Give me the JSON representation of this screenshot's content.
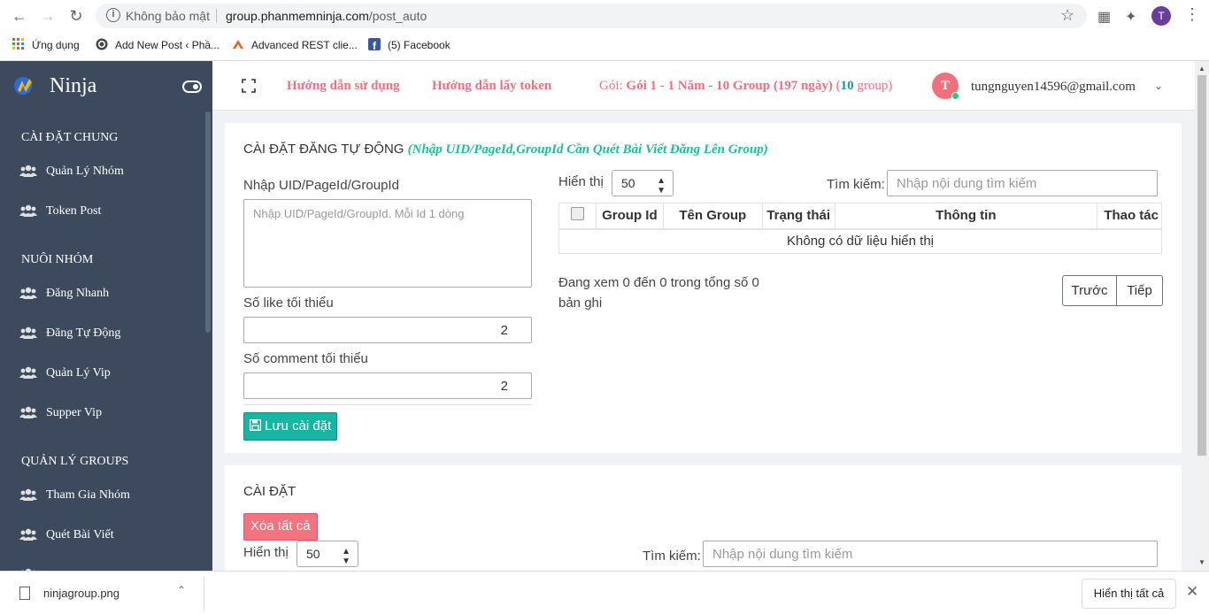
{
  "browser": {
    "insecure_label": "Không bảo mật",
    "url_host": "group.phanmemninja.com",
    "url_path": "/post_auto",
    "profile_initial": "T",
    "bookmarks": [
      {
        "label": "Ứng dụng",
        "icon": "apps-grid-icon"
      },
      {
        "label": "Add New Post ‹ Phầ...",
        "icon": "wordpress-icon"
      },
      {
        "label": "Advanced REST clie...",
        "icon": "rest-client-icon"
      },
      {
        "label": "(5) Facebook",
        "icon": "facebook-icon"
      }
    ]
  },
  "sidebar": {
    "brand": "Ninja",
    "sections": [
      {
        "title": "CÀI ĐẶT CHUNG",
        "items": [
          "Quản Lý Nhóm",
          "Token Post"
        ]
      },
      {
        "title": "NUÔI NHÓM",
        "items": [
          "Đăng Nhanh",
          "Đăng Tự Động",
          "Quản Lý Vip",
          "Supper Vip"
        ]
      },
      {
        "title": "QUẢN LÝ GROUPS",
        "items": [
          "Tham Gia Nhóm",
          "Quét Bài Viết"
        ]
      }
    ]
  },
  "header": {
    "guide_link": "Hướng dẫn sử dụng",
    "token_link": "Hướng dẫn lấy token",
    "package_prefix": "Gói: ",
    "package_name": "Gói 1 - 1 Năm - 10 Group (197 ngày)",
    "group_count": "10",
    "group_suffix": "group)",
    "avatar_initial": "T",
    "email": "tungnguyen14596@gmail.com"
  },
  "card1": {
    "title": "CÀI ĐẶT ĐĂNG TỰ ĐỘNG",
    "subtitle": "(Nhập UID/PageId,GroupId Cần Quét Bài Viết Đăng Lên Group)",
    "uid_label": "Nhập UID/PageId/GroupId",
    "uid_placeholder": "Nhập UID/PageId/GroupId. Mỗi Id 1 dòng",
    "min_like_label": "Số like tối thiểu",
    "min_like_value": "2",
    "min_comment_label": "Số comment tối thiểu",
    "min_comment_value": "2",
    "save_button": "Lưu cài đặt",
    "show_label": "Hiển thị",
    "page_size": "50",
    "search_label": "Tìm kiếm:",
    "search_placeholder": "Nhập nội dung tìm kiếm",
    "table_headers": [
      "Group Id",
      "Tên Group",
      "Trạng thái",
      "Thông tin",
      "Thao tác"
    ],
    "empty_text": "Không có dữ liệu hiển thị",
    "info_line1": "Đang xem 0 đến 0 trong tổng số 0",
    "info_line2": "bản ghi",
    "prev_button": "Trước",
    "next_button": "Tiếp"
  },
  "card2": {
    "title": "CÀI ĐẶT",
    "delete_all_button": "Xóa tất cả",
    "show_label": "Hiển thị",
    "page_size": "50",
    "search_label": "Tìm kiếm:",
    "search_placeholder": "Nhập nội dung tìm kiếm"
  },
  "downloads": {
    "file_name": "ninjagroup.png",
    "show_all": "Hiển thị tất cả"
  },
  "colors": {
    "sidebar_bg": "#3d4a5e",
    "accent_pink": "#f2707e",
    "accent_teal": "#17b6a3",
    "accent_green_italic": "#1ec18e"
  }
}
